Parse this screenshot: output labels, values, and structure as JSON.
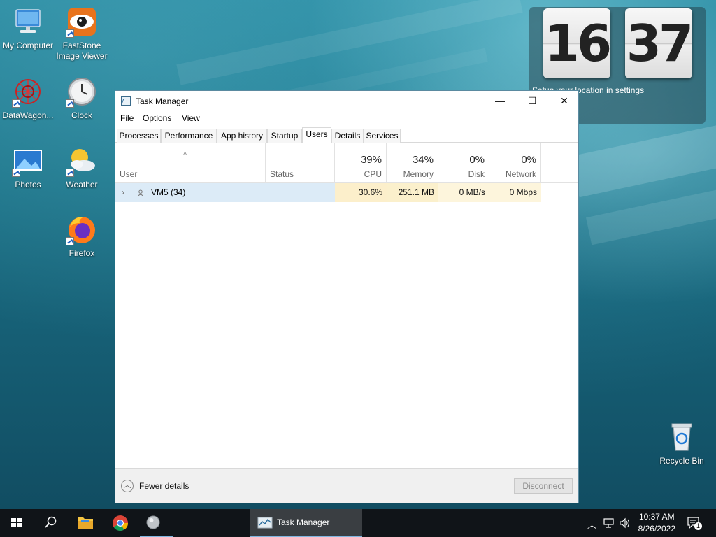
{
  "desktop": {
    "icons": [
      {
        "label": "My Computer"
      },
      {
        "label": "FastStone Image Viewer"
      },
      {
        "label": "DataWagon..."
      },
      {
        "label": "Clock"
      },
      {
        "label": "Photos"
      },
      {
        "label": "Weather"
      },
      {
        "label": "Firefox"
      },
      {
        "label": "Recycle Bin"
      }
    ]
  },
  "clock_widget": {
    "hours": "16",
    "minutes": "37",
    "note": "Setup your location in settings"
  },
  "window": {
    "title": "Task Manager",
    "controls": {
      "minimize": "—",
      "maximize": "☐",
      "close": "✕"
    },
    "menu": [
      "File",
      "Options",
      "View"
    ],
    "tabs": [
      "Processes",
      "Performance",
      "App history",
      "Startup",
      "Users",
      "Details",
      "Services"
    ],
    "active_tab": "Users",
    "columns": {
      "user": "User",
      "status": "Status",
      "cpu": {
        "pct": "39%",
        "name": "CPU"
      },
      "memory": {
        "pct": "34%",
        "name": "Memory"
      },
      "disk": {
        "pct": "0%",
        "name": "Disk"
      },
      "network": {
        "pct": "0%",
        "name": "Network"
      }
    },
    "rows": [
      {
        "user": "VM5 (34)",
        "status": "",
        "cpu": "30.6%",
        "memory": "251.1 MB",
        "disk": "0 MB/s",
        "network": "0 Mbps"
      }
    ],
    "footer": {
      "fewer_details": "Fewer details",
      "disconnect": "Disconnect"
    }
  },
  "taskbar": {
    "task_label": "Task Manager",
    "time": "10:37 AM",
    "date": "8/26/2022",
    "notification_count": "1"
  }
}
